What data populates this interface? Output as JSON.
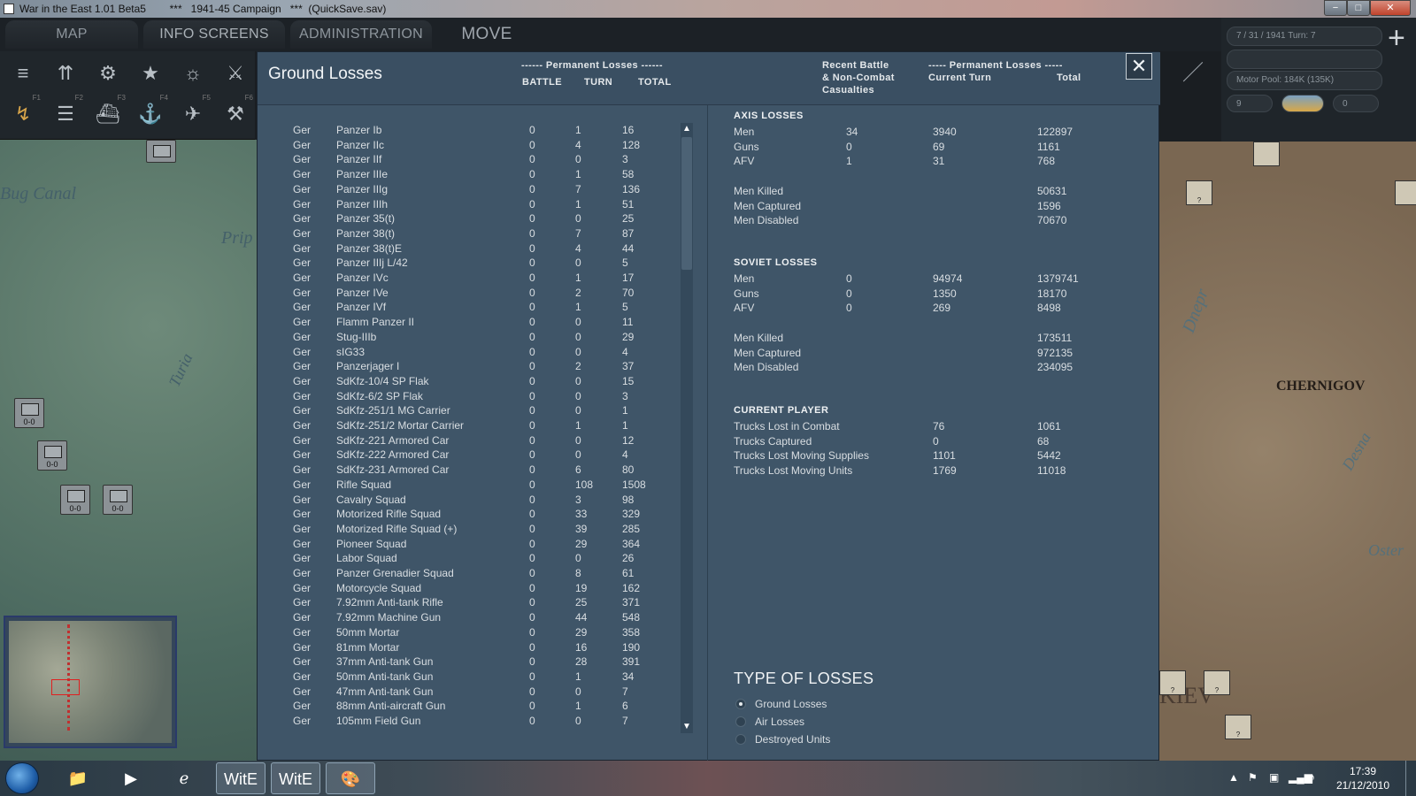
{
  "window": {
    "title": "War in the East 1.01 Beta5        ***   1941-45 Campaign   ***  (QuickSave.sav)",
    "min_glyph": "−",
    "max_glyph": "□",
    "close_glyph": "✕"
  },
  "menu": {
    "map_information": "MAP INFORMATION",
    "info_screens": "INFO SCREENS",
    "administration": "ADMINISTRATION",
    "move": "MOVE"
  },
  "toolbar": {
    "f_keys": [
      "F1",
      "F2",
      "F3",
      "F4",
      "F5",
      "F6"
    ],
    "icons": [
      "stack-icon",
      "units-icon",
      "gear-icon",
      "star-icon",
      "weather-icon",
      "crossed-swords-icon",
      "route-icon",
      "rail-icon",
      "ship-icon",
      "naval-icon",
      "air-icon",
      "engineer-icon"
    ]
  },
  "status": {
    "date_turn": "7 / 31 / 1941      Turn: 7",
    "motor_pool": "Motor Pool:  184K (135K)",
    "small1": "9",
    "small3": "0"
  },
  "map_left": {
    "labels": [
      "Bug Canal",
      "Prip",
      "Turia"
    ],
    "counter_strength": "0-0"
  },
  "map_right": {
    "cities": [
      "CHERNIGOV",
      "KIEV"
    ],
    "rivers": [
      "Dnepr",
      "Desna",
      "Oster"
    ],
    "counter_mark": "?"
  },
  "dialog": {
    "title": "Ground Losses",
    "headers": {
      "perm_losses_1": "------ Permanent Losses ------",
      "battle": "BATTLE",
      "turn": "TURN",
      "total": "TOTAL",
      "recent_1": "Recent Battle",
      "recent_2": "& Non-Combat",
      "recent_3": "Casualties",
      "perm_losses_2": "----- Permanent Losses -----",
      "current_turn": "Current Turn",
      "total2": "Total"
    },
    "close_glyph": "✕"
  },
  "units": [
    {
      "nat": "Ger",
      "name": "Panzer Ib",
      "battle": "0",
      "turn": "1",
      "total": "16"
    },
    {
      "nat": "Ger",
      "name": "Panzer IIc",
      "battle": "0",
      "turn": "4",
      "total": "128"
    },
    {
      "nat": "Ger",
      "name": "Panzer IIf",
      "battle": "0",
      "turn": "0",
      "total": "3"
    },
    {
      "nat": "Ger",
      "name": "Panzer IIIe",
      "battle": "0",
      "turn": "1",
      "total": "58"
    },
    {
      "nat": "Ger",
      "name": "Panzer IIIg",
      "battle": "0",
      "turn": "7",
      "total": "136"
    },
    {
      "nat": "Ger",
      "name": "Panzer IIIh",
      "battle": "0",
      "turn": "1",
      "total": "51"
    },
    {
      "nat": "Ger",
      "name": "Panzer 35(t)",
      "battle": "0",
      "turn": "0",
      "total": "25"
    },
    {
      "nat": "Ger",
      "name": "Panzer 38(t)",
      "battle": "0",
      "turn": "7",
      "total": "87"
    },
    {
      "nat": "Ger",
      "name": "Panzer 38(t)E",
      "battle": "0",
      "turn": "4",
      "total": "44"
    },
    {
      "nat": "Ger",
      "name": "Panzer IIIj L/42",
      "battle": "0",
      "turn": "0",
      "total": "5"
    },
    {
      "nat": "Ger",
      "name": "Panzer IVc",
      "battle": "0",
      "turn": "1",
      "total": "17"
    },
    {
      "nat": "Ger",
      "name": "Panzer IVe",
      "battle": "0",
      "turn": "2",
      "total": "70"
    },
    {
      "nat": "Ger",
      "name": "Panzer IVf",
      "battle": "0",
      "turn": "1",
      "total": "5"
    },
    {
      "nat": "Ger",
      "name": "Flamm Panzer II",
      "battle": "0",
      "turn": "0",
      "total": "11"
    },
    {
      "nat": "Ger",
      "name": "Stug-IIIb",
      "battle": "0",
      "turn": "0",
      "total": "29"
    },
    {
      "nat": "Ger",
      "name": "sIG33",
      "battle": "0",
      "turn": "0",
      "total": "4"
    },
    {
      "nat": "Ger",
      "name": "Panzerjager I",
      "battle": "0",
      "turn": "2",
      "total": "37"
    },
    {
      "nat": "Ger",
      "name": "SdKfz-10/4 SP Flak",
      "battle": "0",
      "turn": "0",
      "total": "15"
    },
    {
      "nat": "Ger",
      "name": "SdKfz-6/2 SP Flak",
      "battle": "0",
      "turn": "0",
      "total": "3"
    },
    {
      "nat": "Ger",
      "name": "SdKfz-251/1 MG Carrier",
      "battle": "0",
      "turn": "0",
      "total": "1"
    },
    {
      "nat": "Ger",
      "name": "SdKfz-251/2 Mortar Carrier",
      "battle": "0",
      "turn": "1",
      "total": "1"
    },
    {
      "nat": "Ger",
      "name": "SdKfz-221 Armored Car",
      "battle": "0",
      "turn": "0",
      "total": "12"
    },
    {
      "nat": "Ger",
      "name": "SdKfz-222 Armored Car",
      "battle": "0",
      "turn": "0",
      "total": "4"
    },
    {
      "nat": "Ger",
      "name": "SdKfz-231 Armored Car",
      "battle": "0",
      "turn": "6",
      "total": "80"
    },
    {
      "nat": "Ger",
      "name": "Rifle Squad",
      "battle": "0",
      "turn": "108",
      "total": "1508"
    },
    {
      "nat": "Ger",
      "name": "Cavalry Squad",
      "battle": "0",
      "turn": "3",
      "total": "98"
    },
    {
      "nat": "Ger",
      "name": "Motorized Rifle Squad",
      "battle": "0",
      "turn": "33",
      "total": "329"
    },
    {
      "nat": "Ger",
      "name": "Motorized Rifle Squad (+)",
      "battle": "0",
      "turn": "39",
      "total": "285"
    },
    {
      "nat": "Ger",
      "name": "Pioneer Squad",
      "battle": "0",
      "turn": "29",
      "total": "364"
    },
    {
      "nat": "Ger",
      "name": "Labor Squad",
      "battle": "0",
      "turn": "0",
      "total": "26"
    },
    {
      "nat": "Ger",
      "name": "Panzer Grenadier Squad",
      "battle": "0",
      "turn": "8",
      "total": "61"
    },
    {
      "nat": "Ger",
      "name": "Motorcycle Squad",
      "battle": "0",
      "turn": "19",
      "total": "162"
    },
    {
      "nat": "Ger",
      "name": "7.92mm Anti-tank Rifle",
      "battle": "0",
      "turn": "25",
      "total": "371"
    },
    {
      "nat": "Ger",
      "name": "7.92mm Machine Gun",
      "battle": "0",
      "turn": "44",
      "total": "548"
    },
    {
      "nat": "Ger",
      "name": "50mm Mortar",
      "battle": "0",
      "turn": "29",
      "total": "358"
    },
    {
      "nat": "Ger",
      "name": "81mm Mortar",
      "battle": "0",
      "turn": "16",
      "total": "190"
    },
    {
      "nat": "Ger",
      "name": "37mm Anti-tank Gun",
      "battle": "0",
      "turn": "28",
      "total": "391"
    },
    {
      "nat": "Ger",
      "name": "50mm Anti-tank Gun",
      "battle": "0",
      "turn": "1",
      "total": "34"
    },
    {
      "nat": "Ger",
      "name": "47mm Anti-tank Gun",
      "battle": "0",
      "turn": "0",
      "total": "7"
    },
    {
      "nat": "Ger",
      "name": "88mm Anti-aircraft Gun",
      "battle": "0",
      "turn": "1",
      "total": "6"
    },
    {
      "nat": "Ger",
      "name": "105mm Field Gun",
      "battle": "0",
      "turn": "0",
      "total": "7"
    }
  ],
  "scroll": {
    "up": "▲",
    "down": "▼"
  },
  "summary": {
    "axis_title": "AXIS LOSSES",
    "axis": [
      {
        "label": "Men",
        "recent": "34",
        "cur": "3940",
        "tot": "122897"
      },
      {
        "label": "Guns",
        "recent": "0",
        "cur": "69",
        "tot": "1161"
      },
      {
        "label": "AFV",
        "recent": "1",
        "cur": "31",
        "tot": "768"
      }
    ],
    "axis_detail": [
      {
        "label": "Men Killed",
        "tot": "50631"
      },
      {
        "label": "Men Captured",
        "tot": "1596"
      },
      {
        "label": "Men Disabled",
        "tot": "70670"
      }
    ],
    "soviet_title": "SOVIET LOSSES",
    "soviet": [
      {
        "label": "Men",
        "recent": "0",
        "cur": "94974",
        "tot": "1379741"
      },
      {
        "label": "Guns",
        "recent": "0",
        "cur": "1350",
        "tot": "18170"
      },
      {
        "label": "AFV",
        "recent": "0",
        "cur": "269",
        "tot": "8498"
      }
    ],
    "soviet_detail": [
      {
        "label": "Men Killed",
        "tot": "173511"
      },
      {
        "label": "Men Captured",
        "tot": "972135"
      },
      {
        "label": "Men Disabled",
        "tot": "234095"
      }
    ],
    "player_title": "CURRENT PLAYER",
    "player": [
      {
        "label": "Trucks Lost in Combat",
        "cur": "76",
        "tot": "1061"
      },
      {
        "label": "Trucks Captured",
        "cur": "0",
        "tot": "68"
      },
      {
        "label": "Trucks Lost Moving Supplies",
        "cur": "1101",
        "tot": "5442"
      },
      {
        "label": "Trucks Lost Moving Units",
        "cur": "1769",
        "tot": "11018"
      }
    ]
  },
  "types": {
    "title": "TYPE OF LOSSES",
    "options": [
      "Ground Losses",
      "Air Losses",
      "Destroyed Units"
    ],
    "selected": "Ground Losses"
  },
  "taskbar": {
    "time": "17:39",
    "date": "21/12/2010",
    "witw_label": "WitE"
  }
}
